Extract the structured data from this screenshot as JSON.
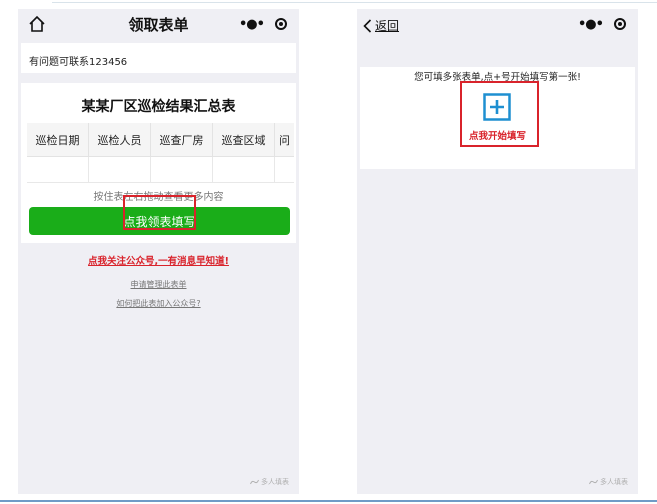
{
  "colors": {
    "accent_green": "#1aad19",
    "highlight_red": "#d9232b",
    "plus_blue": "#1e8fd1",
    "page_bg": "#efeff4"
  },
  "left_screen": {
    "nav": {
      "title": "领取表单",
      "home_icon": "home-icon",
      "more_icon": "more-dots-icon",
      "close_icon": "target-icon"
    },
    "contact_text": "有问题可联系123456",
    "form_title": "某某厂区巡检结果汇总表",
    "table": {
      "columns": [
        "巡检日期",
        "巡检人员",
        "巡查厂房",
        "巡查区域",
        "问"
      ],
      "rows": [
        [
          "",
          "",
          "",
          "",
          ""
        ]
      ]
    },
    "scroll_hint": "按住表左右拖动查看更多内容",
    "fill_button": "点我领表填写",
    "follow_link": "点我关注公众号,一有消息早知道!",
    "manage_link": "申请管理此表单",
    "add_link": "如何把此表加入公众号?",
    "brand": "多人填表"
  },
  "right_screen": {
    "nav": {
      "back_label": "返回",
      "more_icon": "more-dots-icon",
      "close_icon": "target-icon"
    },
    "multi_hint": "您可填多张表单,点+号开始填写第一张!",
    "plus_icon": "plus-square-icon",
    "start_label": "点我开始填写",
    "brand": "多人填表"
  }
}
